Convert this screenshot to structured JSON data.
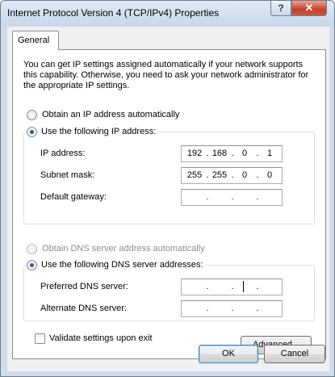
{
  "window": {
    "title": "Internet Protocol Version 4 (TCP/IPv4) Properties",
    "help_glyph": "?",
    "close_glyph": "✕"
  },
  "tabs": [
    {
      "label": "General",
      "selected": true
    }
  ],
  "description": "You can get IP settings assigned automatically if your network supports this capability. Otherwise, you need to ask your network administrator for the appropriate IP settings.",
  "ip": {
    "auto_label": "Obtain an IP address automatically",
    "auto_selected": false,
    "manual_label": "Use the following IP address:",
    "manual_selected": true,
    "fields": [
      {
        "label": "IP address:",
        "octets": [
          "192",
          "168",
          "0",
          "1"
        ]
      },
      {
        "label": "Subnet mask:",
        "octets": [
          "255",
          "255",
          "0",
          "0"
        ]
      },
      {
        "label": "Default gateway:",
        "octets": [
          "",
          "",
          "",
          ""
        ]
      }
    ]
  },
  "dns": {
    "auto_label": "Obtain DNS server address automatically",
    "auto_selected": false,
    "auto_disabled": true,
    "manual_label": "Use the following DNS server addresses:",
    "manual_selected": true,
    "fields": [
      {
        "label": "Preferred DNS server:",
        "octets": [
          "",
          "",
          "",
          ""
        ]
      },
      {
        "label": "Alternate DNS server:",
        "octets": [
          "",
          "",
          "",
          ""
        ]
      }
    ]
  },
  "validate": {
    "label": "Validate settings upon exit",
    "checked": false
  },
  "buttons": {
    "advanced": "Advanced...",
    "ok": "OK",
    "cancel": "Cancel"
  },
  "colors": {
    "frame": "#cfdcea",
    "close": "#c5402a",
    "radio_dot": "#2b5f95"
  }
}
